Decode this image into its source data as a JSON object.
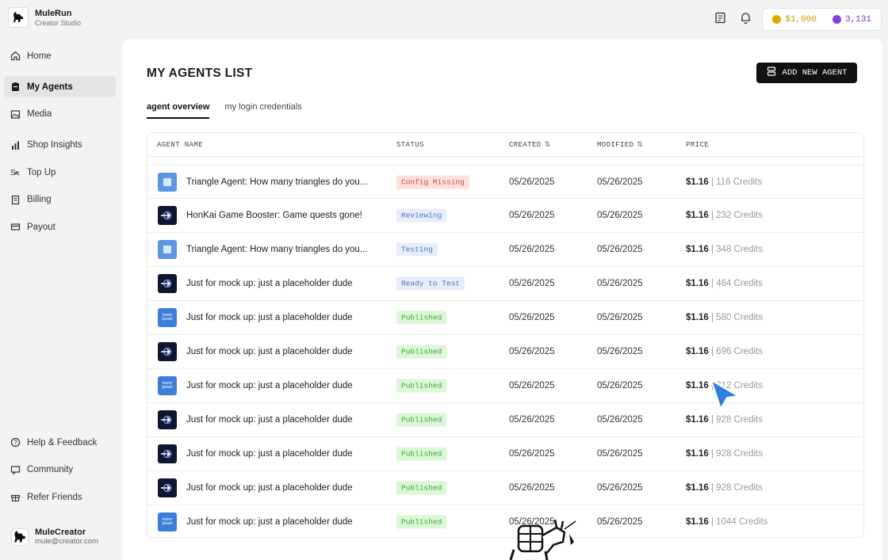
{
  "brand": {
    "name": "MuleRun",
    "subtitle": "Creator Studio"
  },
  "sidebar": {
    "items": [
      {
        "label": "Home",
        "icon": "home-icon"
      },
      {
        "label": "My Agents",
        "icon": "clipboard-icon",
        "active": true
      },
      {
        "label": "Media",
        "icon": "image-icon"
      },
      {
        "label": "Shop Insights",
        "icon": "bar-chart-icon"
      },
      {
        "label": "Top Up",
        "icon": "topup-icon"
      },
      {
        "label": "Billing",
        "icon": "receipt-icon"
      },
      {
        "label": "Payout",
        "icon": "card-icon"
      }
    ],
    "bottom_items": [
      {
        "label": "Help & Feedback",
        "icon": "help-icon"
      },
      {
        "label": "Community",
        "icon": "chat-icon"
      },
      {
        "label": "Refer Friends",
        "icon": "gift-icon"
      }
    ],
    "user": {
      "name": "MuleCreator",
      "email": "mule@creator.com"
    }
  },
  "topbar": {
    "balance_usd": "$1,000",
    "balance_credits": "3,131",
    "colors": {
      "usd": "#e0a800",
      "credits": "#8b3dd9"
    }
  },
  "main": {
    "title": "MY AGENTS LIST",
    "add_button": "ADD NEW AGENT",
    "tabs": [
      {
        "label": "agent overview",
        "active": true
      },
      {
        "label": "my login credentials",
        "active": false
      }
    ],
    "table": {
      "headers": {
        "name": "AGENT NAME",
        "status": "STATUS",
        "created": "CREATED",
        "modified": "MODIFIED",
        "price": "PRICE"
      },
      "rows": [
        {
          "thumb": "tri",
          "name": "Triangle Agent: How many triangles do you...",
          "status": "Config Missing",
          "status_type": "config",
          "created": "05/26/2025",
          "modified": "05/26/2025",
          "price": "$1.16",
          "credits": "| 116 Credits"
        },
        {
          "thumb": "hk",
          "name": "HonKai Game Booster: Game quests gone!",
          "status": "Reviewing",
          "status_type": "review",
          "created": "05/26/2025",
          "modified": "05/26/2025",
          "price": "$1.16",
          "credits": "| 232 Credits"
        },
        {
          "thumb": "tri",
          "name": "Triangle Agent: How many triangles do you...",
          "status": "Testing",
          "status_type": "testing",
          "created": "05/26/2025",
          "modified": "05/26/2025",
          "price": "$1.16",
          "credits": "| 348 Credits"
        },
        {
          "thumb": "hk",
          "name": "Just for mock up: just a placeholder dude",
          "status": "Ready to Test",
          "status_type": "ready",
          "created": "05/26/2025",
          "modified": "05/26/2025",
          "price": "$1.16",
          "credits": "| 464 Credits"
        },
        {
          "thumb": "lp",
          "name": "Just for mock up: just a placeholder dude",
          "status": "Published",
          "status_type": "pub",
          "created": "05/26/2025",
          "modified": "05/26/2025",
          "price": "$1.16",
          "credits": "| 580 Credits"
        },
        {
          "thumb": "hk",
          "name": "Just for mock up: just a placeholder dude",
          "status": "Published",
          "status_type": "pub",
          "created": "05/26/2025",
          "modified": "05/26/2025",
          "price": "$1.16",
          "credits": "| 696 Credits"
        },
        {
          "thumb": "lp",
          "name": "Just for mock up: just a placeholder dude",
          "status": "Published",
          "status_type": "pub",
          "created": "05/26/2025",
          "modified": "05/26/2025",
          "price": "$1.16",
          "credits": "| 812 Credits"
        },
        {
          "thumb": "hk",
          "name": "Just for mock up: just a placeholder dude",
          "status": "Published",
          "status_type": "pub",
          "created": "05/26/2025",
          "modified": "05/26/2025",
          "price": "$1.16",
          "credits": "| 928 Credits"
        },
        {
          "thumb": "hk",
          "name": "Just for mock up: just a placeholder dude",
          "status": "Published",
          "status_type": "pub",
          "created": "05/26/2025",
          "modified": "05/26/2025",
          "price": "$1.16",
          "credits": "| 928 Credits"
        },
        {
          "thumb": "hk",
          "name": "Just for mock up: just a placeholder dude",
          "status": "Published",
          "status_type": "pub",
          "created": "05/26/2025",
          "modified": "05/26/2025",
          "price": "$1.16",
          "credits": "| 928 Credits"
        },
        {
          "thumb": "lp",
          "name": "Just for mock up: just a placeholder dude",
          "status": "Published",
          "status_type": "pub",
          "created": "05/26/2025",
          "modified": "05/26/2025",
          "price": "$1.16",
          "credits": "| 1044 Credits"
        }
      ]
    }
  }
}
